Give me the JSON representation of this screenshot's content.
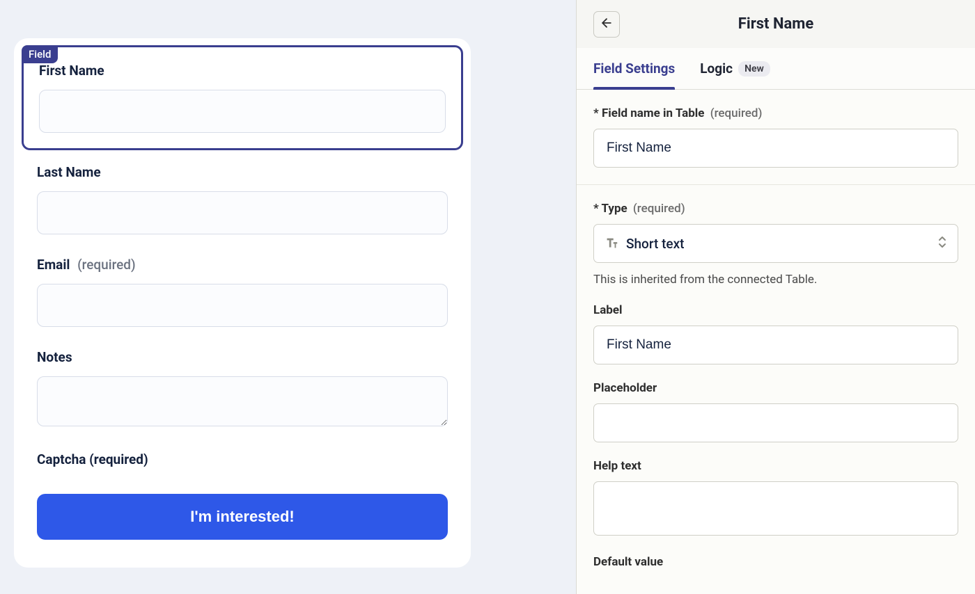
{
  "form": {
    "field_tag": "Field",
    "fields": [
      {
        "label": "First Name",
        "required": false,
        "selected": true,
        "kind": "text"
      },
      {
        "label": "Last Name",
        "required": false,
        "selected": false,
        "kind": "text"
      },
      {
        "label": "Email",
        "required": true,
        "selected": false,
        "kind": "text"
      },
      {
        "label": "Notes",
        "required": false,
        "selected": false,
        "kind": "textarea"
      }
    ],
    "required_suffix": "(required)",
    "captcha_label": "Captcha (required)",
    "submit_label": "I'm interested!"
  },
  "panel": {
    "title": "First Name",
    "tabs": {
      "field_settings": "Field Settings",
      "logic": "Logic",
      "logic_badge": "New"
    },
    "settings": {
      "field_name_label": "* Field name in Table",
      "field_name_required": "(required)",
      "field_name_value": "First Name",
      "type_label": "* Type",
      "type_required": "(required)",
      "type_value": "Short text",
      "type_help": "This is inherited from the connected Table.",
      "label_label": "Label",
      "label_value": "First Name",
      "placeholder_label": "Placeholder",
      "placeholder_value": "",
      "helptext_label": "Help text",
      "helptext_value": "",
      "default_label": "Default value"
    }
  }
}
